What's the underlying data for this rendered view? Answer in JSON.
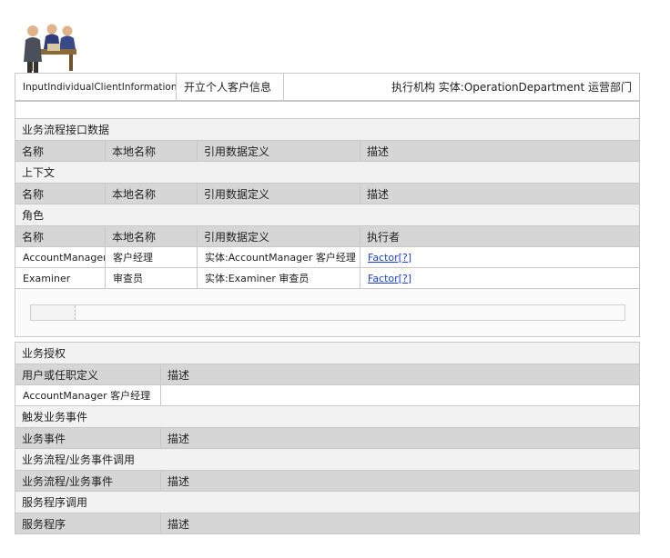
{
  "header": {
    "process_id": "InputIndividualClientInformation",
    "process_name": "开立个人客户信息",
    "executor": "执行机构 实体:OperationDepartment 运营部门"
  },
  "sections": {
    "interface_data": "业务流程接口数据",
    "context": "上下文",
    "roles": "角色",
    "authorization": "业务授权",
    "trigger_events": "触发业务事件",
    "process_invocation": "业务流程/业务事件调用",
    "service_invocation": "服务程序调用"
  },
  "columns": {
    "name": "名称",
    "local_name": "本地名称",
    "ref_data_def": "引用数据定义",
    "description": "描述",
    "executor": "执行者",
    "user_or_position": "用户或任职定义",
    "biz_event": "业务事件",
    "process_or_event": "业务流程/业务事件",
    "service": "服务程序"
  },
  "roles": [
    {
      "name": "AccountManager",
      "local": "客户经理",
      "ref": "实体:AccountManager 客户经理",
      "executor": "Factor[?]"
    },
    {
      "name": "Examiner",
      "local": "审查员",
      "ref": "实体:Examiner 审查员",
      "executor": "Factor[?]"
    }
  ],
  "authorization_rows": [
    {
      "user": "AccountManager 客户经理",
      "desc": ""
    }
  ]
}
